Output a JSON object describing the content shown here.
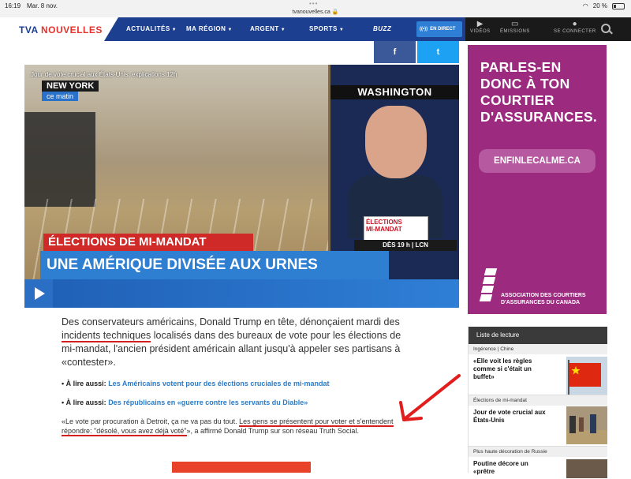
{
  "status": {
    "time": "16:19",
    "date": "Mar. 8 nov.",
    "url": "tvanouvelles.ca",
    "battery": "20 %"
  },
  "nav": {
    "logo_tva": "TVA",
    "logo_nouvelles": "NOUVELLES",
    "items": [
      {
        "label": "ACTUALITÉS"
      },
      {
        "label": "MA RÉGION"
      },
      {
        "label": "ARGENT"
      },
      {
        "label": "SPORTS"
      },
      {
        "label": "BUZZ"
      }
    ],
    "direct": "EN DIRECT",
    "videos": "VIDÉOS",
    "emissions": "ÉMISSIONS",
    "login": "SE CONNECTER",
    "colors": {
      "brand_blue": "#1c3f8f",
      "brand_red": "#e5322c"
    }
  },
  "share": {
    "facebook": "f",
    "twitter": "t"
  },
  "video": {
    "title": "Jour de vote crucial aux États-Unis: explications 12h",
    "location_tag": "NEW YORK",
    "time_tag": "ce matin",
    "right_tag": "WASHINGTON",
    "badge_line1": "ÉLECTIONS",
    "badge_line2": "MI-MANDAT",
    "schedule": "DÈS 19 h | LCN",
    "band_small": "ÉLECTIONS DE MI-MANDAT",
    "band_large": "UNE AMÉRIQUE DIVISÉE AUX URNES"
  },
  "article": {
    "lead_pre": "Des conservateurs américains, Donald Trump en tête, dénonçaient mardi des ",
    "lead_ul": "incidents techniques",
    "lead_post": " localisés dans des bureaux de vote pour les élections de mi-mandat, l'ancien président américain allant jusqu'à appeler ses partisans à «contester».",
    "also1_label": "• À lire aussi:",
    "also1_link": "Les Américains votent pour des élections cruciales de mi-mandat",
    "also2_label": "• À lire aussi:",
    "also2_link": "Des républicains en «guerre contre les servants du Diable»",
    "quote_pre": "«Le vote par procuration à Detroit, ça ne va pas du tout. ",
    "quote_ul": "Les gens se présentent pour voter et s'entendent répondre: \"désolé, vous avez déjà voté\"",
    "quote_post": "», a affirmé Donald Trump sur son réseau Truth Social."
  },
  "ad": {
    "headline": "PARLES-EN DONC À TON COURTIER D'ASSURANCES.",
    "button": "ENFINLECALME.CA",
    "association": "ASSOCIATION DES COURTIERS D'ASSURANCES DU CANADA",
    "color": "#9c2a7f"
  },
  "reading_list": {
    "header": "Liste de lecture",
    "items": [
      {
        "category": "Ingérence | Chine",
        "title": "«Elle voit les règles comme si c'était un buffet»"
      },
      {
        "category": "Élections de mi-mandat",
        "title": "Jour de vote crucial aux États-Unis"
      },
      {
        "category": "Plus haute décoration de Russie",
        "title": "Poutine décore un «prêtre"
      }
    ]
  }
}
